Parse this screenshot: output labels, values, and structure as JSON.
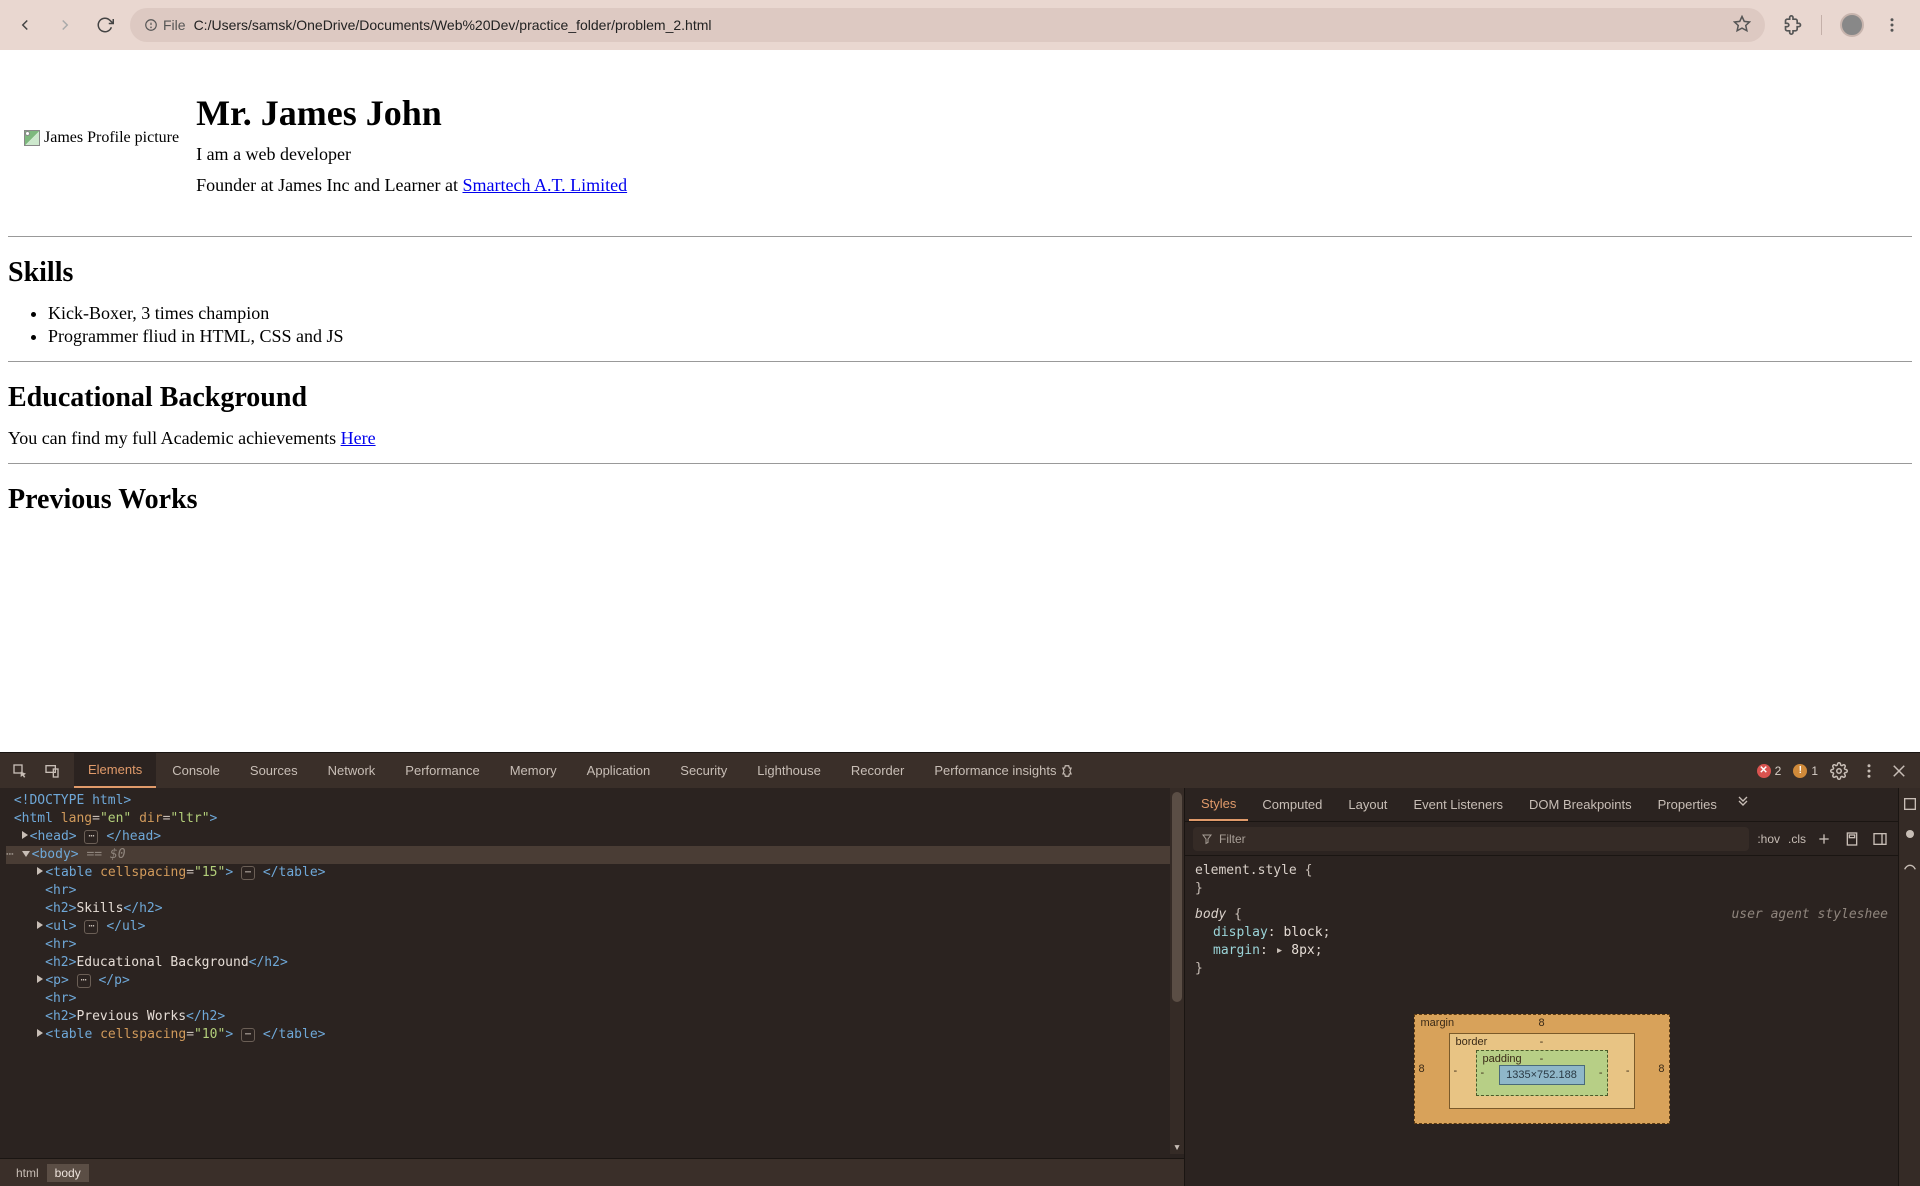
{
  "browser": {
    "file_label": "File",
    "url": "C:/Users/samsk/OneDrive/Documents/Web%20Dev/practice_folder/problem_2.html"
  },
  "page": {
    "img_alt": "James Profile picture",
    "h1": "Mr. James John",
    "intro": "I am a web developer",
    "founder_prefix": "Founder at James Inc and Learner at ",
    "founder_link": "Smartech A.T. Limited",
    "skills_h2": "Skills",
    "skills": [
      "Kick-Boxer, 3 times champion",
      "Programmer fliud in HTML, CSS and JS"
    ],
    "edu_h2": "Educational Background",
    "edu_text_prefix": "You can find my full Academic achievements ",
    "edu_link": "Here",
    "prev_h2": "Previous Works"
  },
  "devtools": {
    "tabs": [
      "Elements",
      "Console",
      "Sources",
      "Network",
      "Performance",
      "Memory",
      "Application",
      "Security",
      "Lighthouse",
      "Recorder",
      "Performance insights"
    ],
    "active_tab": "Elements",
    "errors": "2",
    "warnings": "1",
    "styles_tabs": [
      "Styles",
      "Computed",
      "Layout",
      "Event Listeners",
      "DOM Breakpoints",
      "Properties"
    ],
    "active_styles_tab": "Styles",
    "filter_placeholder": "Filter",
    "hov": ":hov",
    "cls": ".cls",
    "element_style_sel": "element.style",
    "body_sel": "body",
    "ua_label": "user agent styleshee",
    "rule_display_prop": "display",
    "rule_display_val": "block",
    "rule_margin_prop": "margin",
    "rule_margin_val": "8px",
    "brace_open": "{",
    "brace_close": "}",
    "crumbs": [
      "html",
      "body"
    ],
    "box": {
      "margin_label": "margin",
      "border_label": "border",
      "padding_label": "padding",
      "margin_top": "8",
      "margin_left": "8",
      "margin_right": "8",
      "border_top": "-",
      "border_left": "-",
      "border_right": "-",
      "padding_top": "-",
      "padding_left": "-",
      "padding_right": "-",
      "content": "1335×752.188"
    },
    "dom": {
      "doctype": "<!DOCTYPE html>",
      "html_open_pre": "<html ",
      "html_lang_attr": "lang",
      "html_lang_val": "\"en\"",
      "html_dir_attr": "dir",
      "html_dir_val": "\"ltr\"",
      "html_open_post": ">",
      "head_open": "<head>",
      "head_close": "</head>",
      "body_open": "<body>",
      "eq0": " == $0",
      "table1_open_pre": "<table ",
      "table1_attr": "cellspacing",
      "table1_val": "\"15\"",
      "table_close": "</table>",
      "hr": "<hr>",
      "h2_open": "<h2>",
      "h2_close": "</h2>",
      "skills_txt": "Skills",
      "ul_open": "<ul>",
      "ul_close": "</ul>",
      "edu_txt": "Educational Background",
      "p_open": "<p>",
      "p_close": "</p>",
      "prev_txt": "Previous Works",
      "table2_val": "\"10\""
    }
  }
}
